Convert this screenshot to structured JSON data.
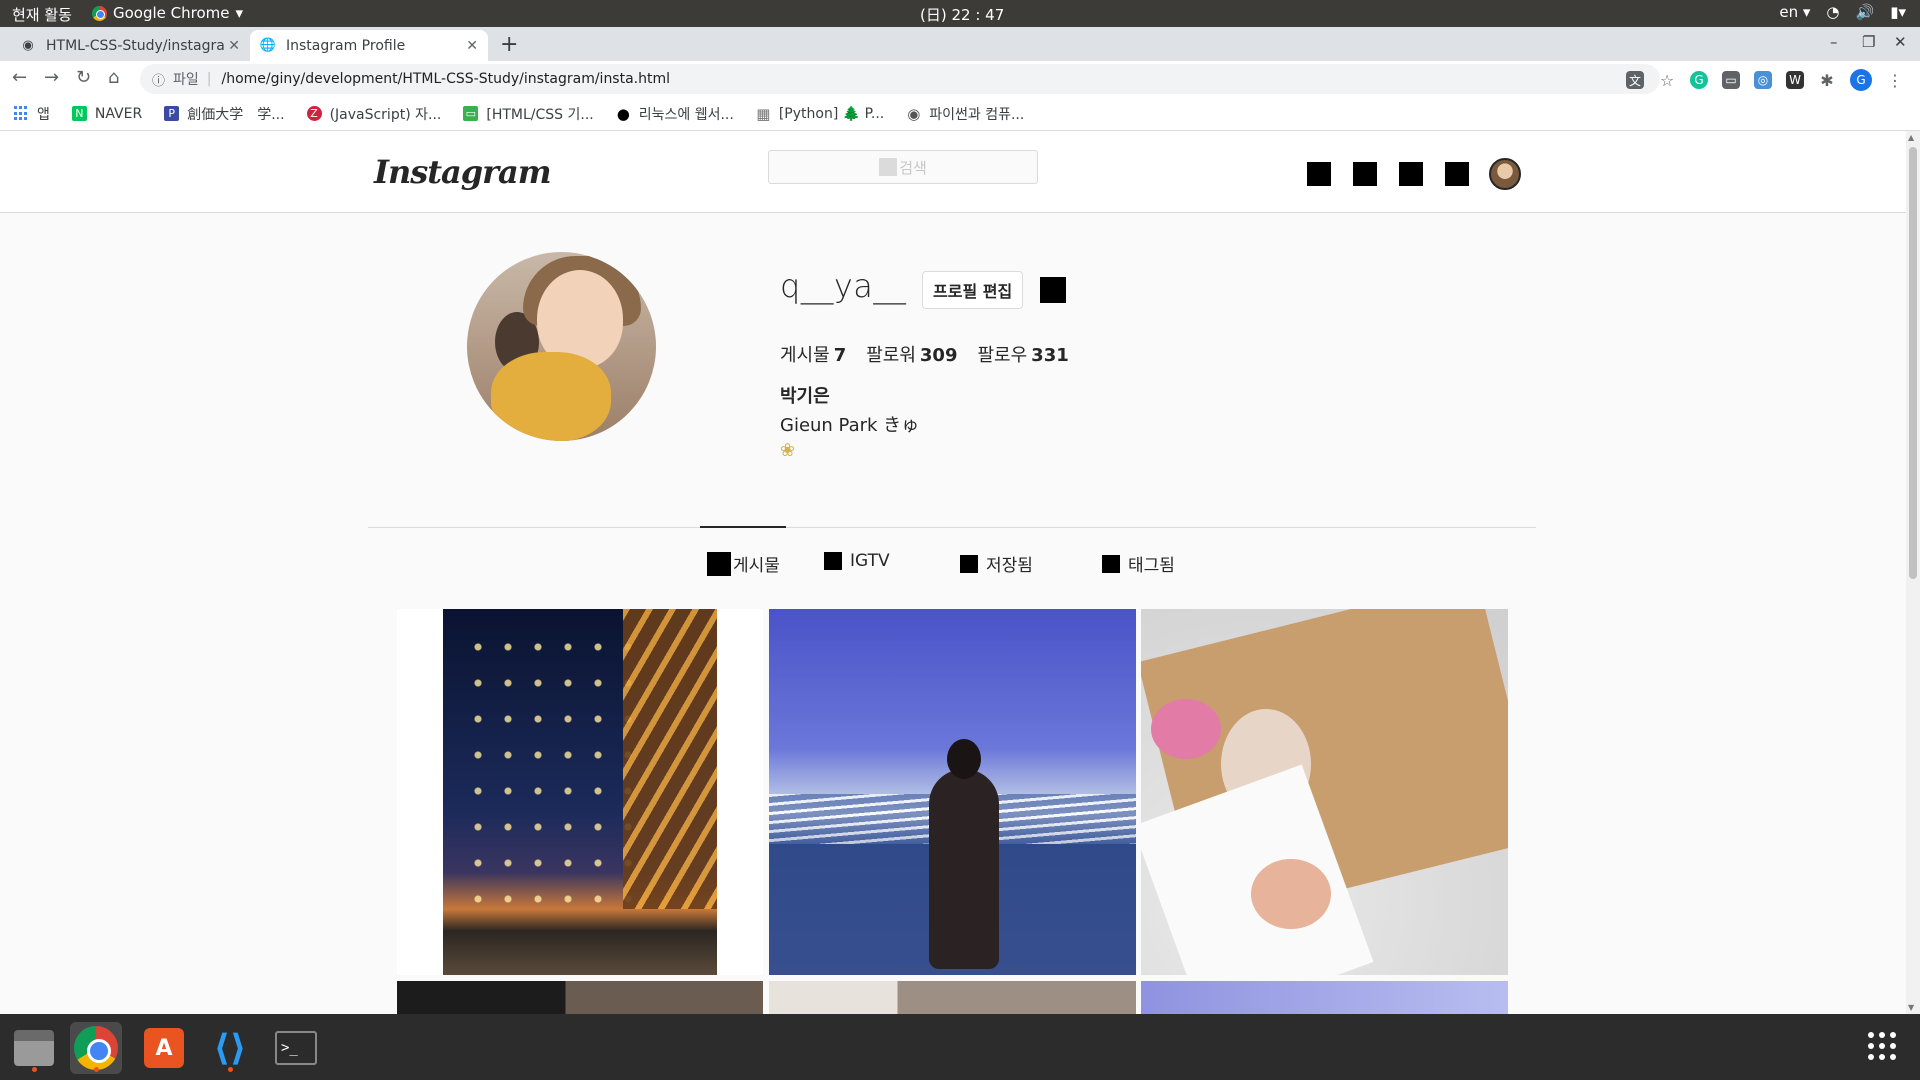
{
  "system": {
    "activities": "현재 활동",
    "app_menu": "Google Chrome",
    "app_menu_caret": "▾",
    "clock": "(日) 22 : 47",
    "lang": "en ▾"
  },
  "browser": {
    "tabs": [
      {
        "title": "HTML-CSS-Study/instagra",
        "icon": "github-icon"
      },
      {
        "title": "Instagram Profile",
        "icon": "globe-icon"
      }
    ],
    "url_scheme": "파일",
    "url": "/home/giny/development/HTML-CSS-Study/instagram/insta.html",
    "bookmarks": [
      {
        "label": "앱",
        "icon": "apps-grid-icon"
      },
      {
        "label": "NAVER",
        "icon": "naver-icon",
        "color": "#03c75a",
        "glyph": "N"
      },
      {
        "label": "創価大学　学...",
        "icon": "soka-icon",
        "color": "#3b4ba0",
        "glyph": "P"
      },
      {
        "label": "(JavaScript) 자...",
        "icon": "bookmark-z-icon",
        "color": "#d0223c",
        "glyph": "Z"
      },
      {
        "label": "[HTML/CSS 기...",
        "icon": "bookmark-green-icon",
        "color": "#37b24d",
        "glyph": "▭"
      },
      {
        "label": "리눅스에 웹서...",
        "icon": "bookmark-dot-icon",
        "color": "#000000",
        "glyph": "●"
      },
      {
        "label": "[Python] 🌲 P...",
        "icon": "bookmark-grid-icon",
        "color": "#777777",
        "glyph": "▦"
      },
      {
        "label": "파이썬과 컴퓨...",
        "icon": "bookmark-target-icon",
        "color": "#555555",
        "glyph": "◉"
      }
    ]
  },
  "instagram": {
    "logo": "Instagram",
    "search_placeholder": "검색",
    "profile": {
      "username": "q__ya__",
      "edit_button": "프로필 편집",
      "stats": [
        {
          "label": "게시물",
          "value": "7"
        },
        {
          "label": "팔로워",
          "value": "309"
        },
        {
          "label": "팔로우",
          "value": "331"
        }
      ],
      "full_name": "박기은",
      "bio": "Gieun Park きゅ",
      "bio_emoji": "❀"
    },
    "tabs": [
      {
        "label": "게시물"
      },
      {
        "label": "IGTV"
      },
      {
        "label": "저장됨"
      },
      {
        "label": "태그됨"
      }
    ]
  }
}
